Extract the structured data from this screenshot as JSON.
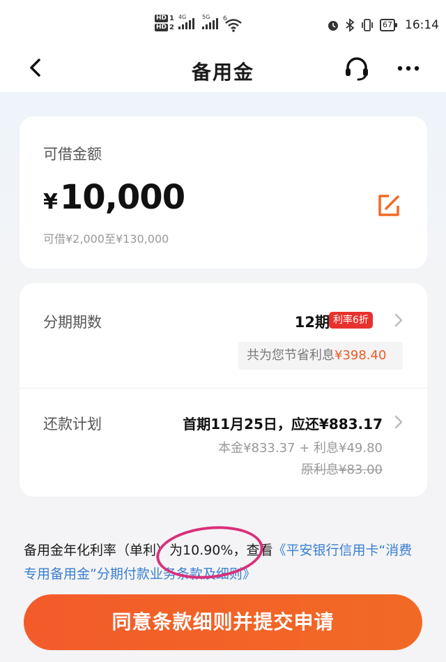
{
  "status_bar": {
    "hd1": "HD",
    "hd1_num": "1",
    "hd2": "HD",
    "hd2_num": "2",
    "network1": "4G",
    "network2": "5G",
    "wifi_num": "6",
    "battery": "67",
    "time": "16:14",
    "icons": [
      "signal-icon",
      "wifi-icon",
      "alarm-icon",
      "bluetooth-icon",
      "vibrate-icon",
      "battery-icon"
    ]
  },
  "nav": {
    "title": "备用金",
    "icons": [
      "back-icon",
      "headset-icon",
      "more-icon"
    ]
  },
  "amount_card": {
    "label": "可借金额",
    "currency": "¥",
    "value": "10,000",
    "range": "可借¥2,000至¥130,000",
    "icon": "edit-icon"
  },
  "plan_card": {
    "terms_label": "分期期数",
    "terms_value": "12期",
    "rate_badge": "利率6折",
    "save_prefix": "共为您节省利息",
    "save_amount": "¥398.40",
    "repay_label": "还款计划",
    "repay_main": "首期11月25日，应还¥883.17",
    "repay_sub": "本金¥833.37 + 利息¥49.80",
    "repay_orig": "原利息¥83.00"
  },
  "notice": {
    "text": "备用金年化利率（单利）为10.90%，查看",
    "link": "《平安银行信用卡“消费专用备用金”分期付款业务条款及细则》"
  },
  "submit": {
    "label": "同意条款细则并提交申请"
  },
  "colors": {
    "accent": "#f35b2a",
    "badge": "#e8322d",
    "link": "#3a7fd0",
    "annotation_circle": "#d9307a"
  }
}
